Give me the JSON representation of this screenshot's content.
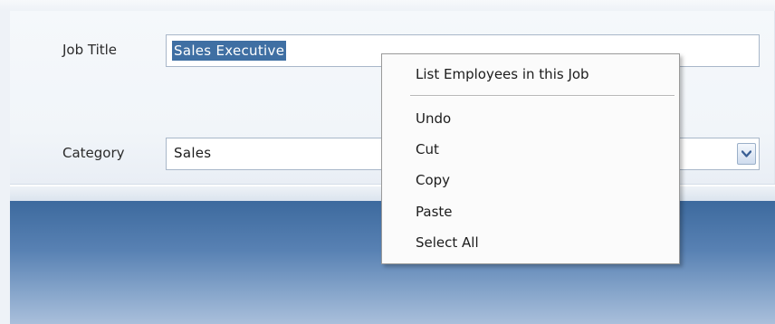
{
  "form": {
    "job_title": {
      "label": "Job Title",
      "value": "Sales Executive"
    },
    "category": {
      "label": "Category",
      "value": "Sales"
    }
  },
  "context_menu": {
    "items": [
      {
        "label": "List Employees in this Job"
      },
      {
        "label": "Undo"
      },
      {
        "label": "Cut"
      },
      {
        "label": "Copy"
      },
      {
        "label": "Paste"
      },
      {
        "label": "Select All"
      }
    ]
  },
  "icons": {
    "dropdown": "chevron-down-icon"
  },
  "colors": {
    "selection": "#3f6fa3",
    "band": "#5881b3",
    "dropdown_arrow": "#3a5f95"
  }
}
